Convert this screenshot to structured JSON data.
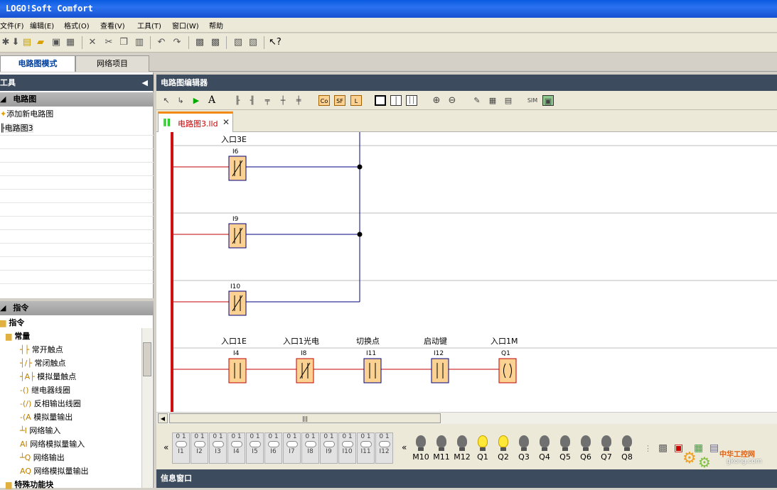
{
  "app": {
    "title": "LOGO!Soft Comfort"
  },
  "menu": [
    {
      "label": "文件(F)"
    },
    {
      "label": "编辑(E)"
    },
    {
      "label": "格式(O)"
    },
    {
      "label": "查看(V)"
    },
    {
      "label": "工具(T)"
    },
    {
      "label": "窗口(W)"
    },
    {
      "label": "帮助"
    }
  ],
  "mode_tabs": [
    {
      "label": "电路图模式",
      "active": true
    },
    {
      "label": "网络项目",
      "active": false
    }
  ],
  "tools_panel": {
    "title": "工具",
    "section": "电路图",
    "items": [
      {
        "label": "添加新电路图"
      },
      {
        "label": "电路图3"
      }
    ]
  },
  "instructions_panel": {
    "title": "指令",
    "root": "指令",
    "constants": "常量",
    "items": [
      {
        "label": "常开触点"
      },
      {
        "label": "常闭触点"
      },
      {
        "label": "模拟量触点"
      },
      {
        "label": "继电器线圈"
      },
      {
        "label": "反相输出线圈"
      },
      {
        "label": "模拟量输出"
      },
      {
        "label": "网络输入"
      },
      {
        "label": "网络模拟量输入"
      },
      {
        "label": "网络输出"
      },
      {
        "label": "网络模拟量输出"
      }
    ],
    "special": "特殊功能块"
  },
  "editor": {
    "title": "电路图编辑器",
    "doc_tab": "电路图3.lld",
    "info_title": "信息窗口"
  },
  "ladder": {
    "rung1": {
      "name": "入口3E",
      "contacts": [
        {
          "id": "I6"
        },
        {
          "id": "I9"
        },
        {
          "id": "I10"
        }
      ]
    },
    "rung2": [
      {
        "name": "入口1E",
        "id": "I4",
        "kind": "NO"
      },
      {
        "name": "入口1光电",
        "id": "I8",
        "kind": "NC"
      },
      {
        "name": "切换点",
        "id": "I11",
        "kind": "NO"
      },
      {
        "name": "启动键",
        "id": "I12",
        "kind": "NO"
      },
      {
        "name": "入口1M",
        "id": "Q1",
        "kind": "coil"
      }
    ]
  },
  "simulation": {
    "switches": [
      "I1",
      "I2",
      "I3",
      "I4",
      "I5",
      "I6",
      "I7",
      "I8",
      "I9",
      "I10",
      "I11",
      "I12"
    ],
    "switch_state": "0 1",
    "outputs": [
      {
        "label": "M10",
        "on": false
      },
      {
        "label": "M11",
        "on": false
      },
      {
        "label": "M12",
        "on": false
      },
      {
        "label": "Q1",
        "on": true
      },
      {
        "label": "Q2",
        "on": true
      },
      {
        "label": "Q3",
        "on": false
      },
      {
        "label": "Q4",
        "on": false
      },
      {
        "label": "Q5",
        "on": false
      },
      {
        "label": "Q6",
        "on": false
      },
      {
        "label": "Q7",
        "on": false
      },
      {
        "label": "Q8",
        "on": false
      }
    ]
  },
  "watermark": {
    "site": "gkong.com",
    "name": "中华工控网"
  },
  "colors": {
    "rail": "#d01010",
    "wire_red": "#c00000",
    "wire_blue": "#000080",
    "contact_fill": "#fbd291",
    "title_bar": "#0a5be0"
  }
}
